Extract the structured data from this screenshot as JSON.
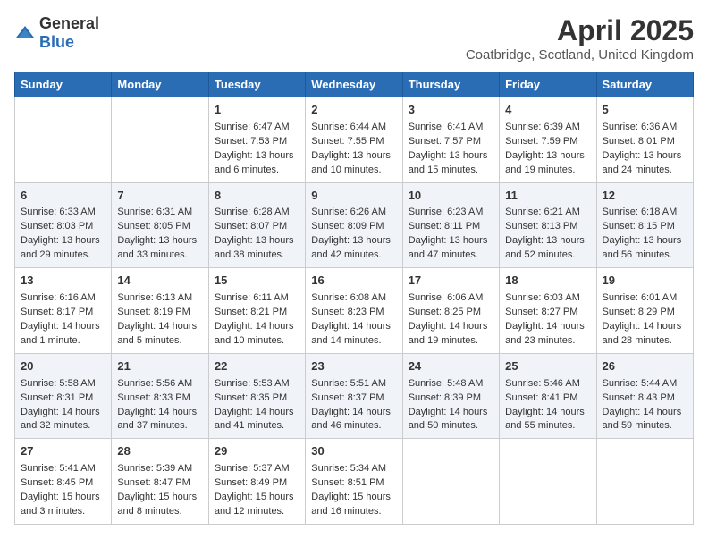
{
  "logo": {
    "text_general": "General",
    "text_blue": "Blue"
  },
  "title": "April 2025",
  "subtitle": "Coatbridge, Scotland, United Kingdom",
  "days_of_week": [
    "Sunday",
    "Monday",
    "Tuesday",
    "Wednesday",
    "Thursday",
    "Friday",
    "Saturday"
  ],
  "weeks": [
    [
      {
        "day": "",
        "content": ""
      },
      {
        "day": "",
        "content": ""
      },
      {
        "day": "1",
        "content": "Sunrise: 6:47 AM\nSunset: 7:53 PM\nDaylight: 13 hours and 6 minutes."
      },
      {
        "day": "2",
        "content": "Sunrise: 6:44 AM\nSunset: 7:55 PM\nDaylight: 13 hours and 10 minutes."
      },
      {
        "day": "3",
        "content": "Sunrise: 6:41 AM\nSunset: 7:57 PM\nDaylight: 13 hours and 15 minutes."
      },
      {
        "day": "4",
        "content": "Sunrise: 6:39 AM\nSunset: 7:59 PM\nDaylight: 13 hours and 19 minutes."
      },
      {
        "day": "5",
        "content": "Sunrise: 6:36 AM\nSunset: 8:01 PM\nDaylight: 13 hours and 24 minutes."
      }
    ],
    [
      {
        "day": "6",
        "content": "Sunrise: 6:33 AM\nSunset: 8:03 PM\nDaylight: 13 hours and 29 minutes."
      },
      {
        "day": "7",
        "content": "Sunrise: 6:31 AM\nSunset: 8:05 PM\nDaylight: 13 hours and 33 minutes."
      },
      {
        "day": "8",
        "content": "Sunrise: 6:28 AM\nSunset: 8:07 PM\nDaylight: 13 hours and 38 minutes."
      },
      {
        "day": "9",
        "content": "Sunrise: 6:26 AM\nSunset: 8:09 PM\nDaylight: 13 hours and 42 minutes."
      },
      {
        "day": "10",
        "content": "Sunrise: 6:23 AM\nSunset: 8:11 PM\nDaylight: 13 hours and 47 minutes."
      },
      {
        "day": "11",
        "content": "Sunrise: 6:21 AM\nSunset: 8:13 PM\nDaylight: 13 hours and 52 minutes."
      },
      {
        "day": "12",
        "content": "Sunrise: 6:18 AM\nSunset: 8:15 PM\nDaylight: 13 hours and 56 minutes."
      }
    ],
    [
      {
        "day": "13",
        "content": "Sunrise: 6:16 AM\nSunset: 8:17 PM\nDaylight: 14 hours and 1 minute."
      },
      {
        "day": "14",
        "content": "Sunrise: 6:13 AM\nSunset: 8:19 PM\nDaylight: 14 hours and 5 minutes."
      },
      {
        "day": "15",
        "content": "Sunrise: 6:11 AM\nSunset: 8:21 PM\nDaylight: 14 hours and 10 minutes."
      },
      {
        "day": "16",
        "content": "Sunrise: 6:08 AM\nSunset: 8:23 PM\nDaylight: 14 hours and 14 minutes."
      },
      {
        "day": "17",
        "content": "Sunrise: 6:06 AM\nSunset: 8:25 PM\nDaylight: 14 hours and 19 minutes."
      },
      {
        "day": "18",
        "content": "Sunrise: 6:03 AM\nSunset: 8:27 PM\nDaylight: 14 hours and 23 minutes."
      },
      {
        "day": "19",
        "content": "Sunrise: 6:01 AM\nSunset: 8:29 PM\nDaylight: 14 hours and 28 minutes."
      }
    ],
    [
      {
        "day": "20",
        "content": "Sunrise: 5:58 AM\nSunset: 8:31 PM\nDaylight: 14 hours and 32 minutes."
      },
      {
        "day": "21",
        "content": "Sunrise: 5:56 AM\nSunset: 8:33 PM\nDaylight: 14 hours and 37 minutes."
      },
      {
        "day": "22",
        "content": "Sunrise: 5:53 AM\nSunset: 8:35 PM\nDaylight: 14 hours and 41 minutes."
      },
      {
        "day": "23",
        "content": "Sunrise: 5:51 AM\nSunset: 8:37 PM\nDaylight: 14 hours and 46 minutes."
      },
      {
        "day": "24",
        "content": "Sunrise: 5:48 AM\nSunset: 8:39 PM\nDaylight: 14 hours and 50 minutes."
      },
      {
        "day": "25",
        "content": "Sunrise: 5:46 AM\nSunset: 8:41 PM\nDaylight: 14 hours and 55 minutes."
      },
      {
        "day": "26",
        "content": "Sunrise: 5:44 AM\nSunset: 8:43 PM\nDaylight: 14 hours and 59 minutes."
      }
    ],
    [
      {
        "day": "27",
        "content": "Sunrise: 5:41 AM\nSunset: 8:45 PM\nDaylight: 15 hours and 3 minutes."
      },
      {
        "day": "28",
        "content": "Sunrise: 5:39 AM\nSunset: 8:47 PM\nDaylight: 15 hours and 8 minutes."
      },
      {
        "day": "29",
        "content": "Sunrise: 5:37 AM\nSunset: 8:49 PM\nDaylight: 15 hours and 12 minutes."
      },
      {
        "day": "30",
        "content": "Sunrise: 5:34 AM\nSunset: 8:51 PM\nDaylight: 15 hours and 16 minutes."
      },
      {
        "day": "",
        "content": ""
      },
      {
        "day": "",
        "content": ""
      },
      {
        "day": "",
        "content": ""
      }
    ]
  ]
}
